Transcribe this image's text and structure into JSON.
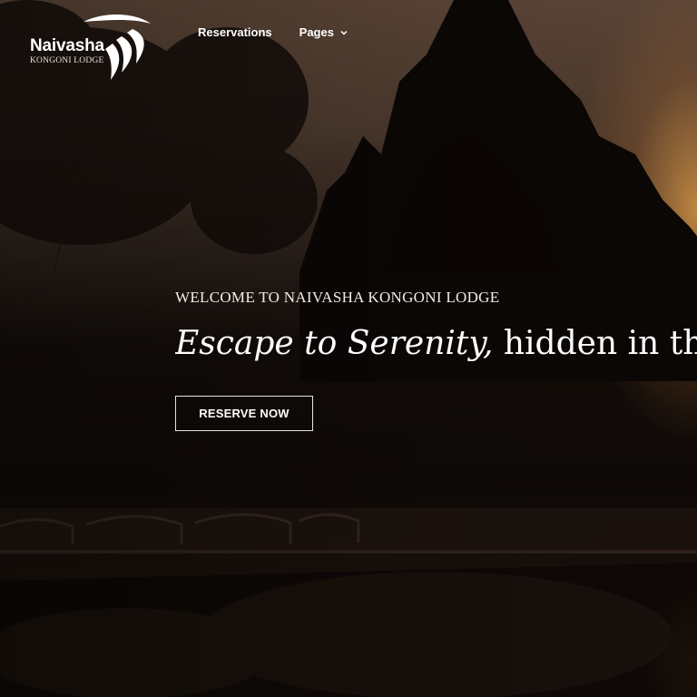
{
  "brand": {
    "name": "Naivasha",
    "subtitle": "KONGONI LODGE"
  },
  "nav": {
    "items": [
      {
        "label": "Reservations"
      },
      {
        "label": "Pages",
        "icon": "chevron-down-icon"
      }
    ]
  },
  "hero": {
    "eyebrow": "WELCOME TO NAIVASHA KONGONI LODGE",
    "headline_em": "Escape to Serenity,",
    "headline_rest": "hidden in the h",
    "cta_label": "RESERVE NOW"
  },
  "colors": {
    "text": "#ffffff",
    "sunset": "#d69648",
    "background": "#0c0806"
  }
}
